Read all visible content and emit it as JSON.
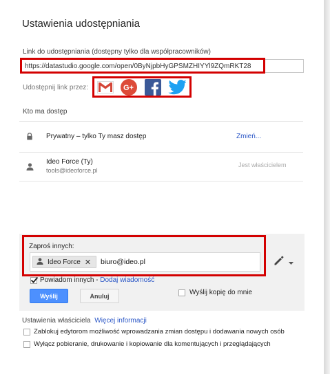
{
  "dialog": {
    "title": "Ustawienia udostępniania"
  },
  "link": {
    "label": "Link do udostępniania (dostępny tylko dla współpracowników)",
    "url": "https://datastudio.google.com/open/0ByNjpbHyGPSMZHIYYl9ZQmRKT28"
  },
  "share": {
    "label": "Udostępnij link przez:",
    "services": [
      {
        "name": "gmail-icon",
        "color": "#d44638"
      },
      {
        "name": "google-plus-icon",
        "color": "#dd4b39"
      },
      {
        "name": "facebook-icon",
        "color": "#3b5998"
      },
      {
        "name": "twitter-icon",
        "color": "#1da1f2"
      }
    ]
  },
  "access": {
    "label": "Kto ma dostęp",
    "privacy": {
      "icon": "lock-icon",
      "text": "Prywatny – tylko Ty masz dostęp",
      "change": "Zmień..."
    },
    "owner": {
      "icon": "person-icon",
      "name": "Ideo Force (Ty)",
      "email": "tools@ideoforce.pl",
      "role": "Jest właścicielem"
    }
  },
  "invite": {
    "label": "Zaproś innych:",
    "chip": "Ideo Force",
    "value": "biuro@ideo.pl",
    "notify_label": "Powiadom innych -",
    "add_message": "Dodaj wiadomość",
    "send": "Wyślij",
    "cancel": "Anuluj",
    "copy_me": "Wyślij kopię do mnie"
  },
  "owner_settings": {
    "label": "Ustawienia właściciela",
    "more": "Więcej informacji",
    "option1": "Zablokuj edytorom możliwość wprowadzania zmian dostępu i dodawania nowych osób",
    "option2": "Wyłącz pobieranie, drukowanie i kopiowanie dla komentujących i przeglądających"
  },
  "colors": {
    "accent": "#4d90fe",
    "link": "#2a56c6",
    "highlight": "#d30000"
  }
}
